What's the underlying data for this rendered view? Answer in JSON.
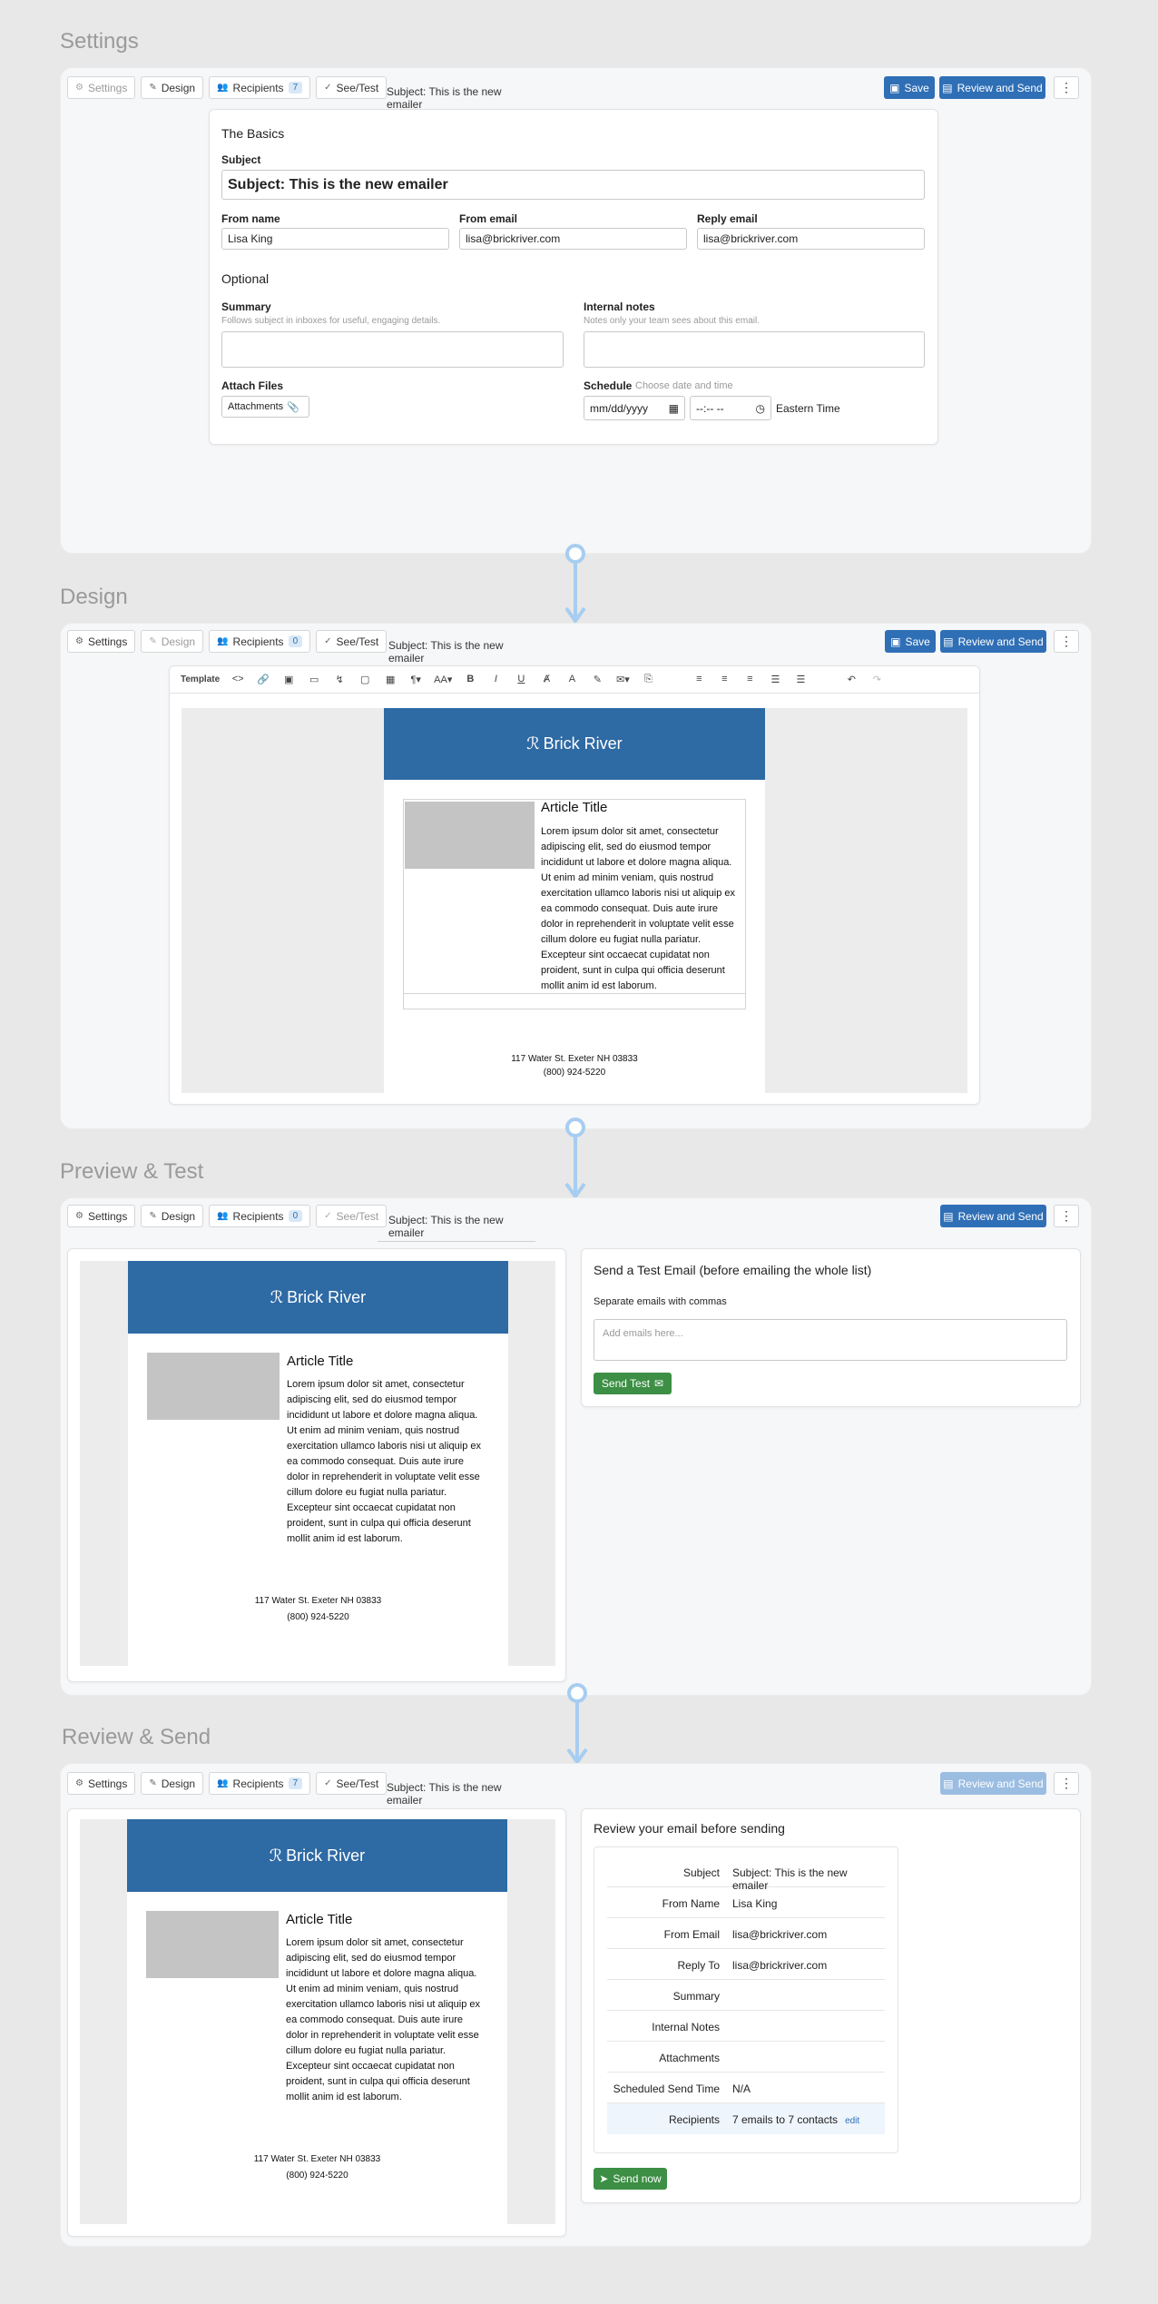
{
  "sections": {
    "settings": "Settings",
    "design": "Design",
    "preview": "Preview & Test",
    "review": "Review & Send"
  },
  "tabs": {
    "settings": "Settings",
    "design": "Design",
    "recipients": "Recipients",
    "seetest": "See/Test"
  },
  "counts": {
    "s1": "7",
    "s2": "0",
    "s3": "0",
    "s4": "7"
  },
  "subject_line": "Subject: This is the new emailer",
  "buttons": {
    "save": "Save",
    "review_send": "Review and Send",
    "send_test": "Send Test",
    "send_now": "Send now"
  },
  "settings": {
    "basics_title": "The Basics",
    "subject_label": "Subject",
    "subject_value": "Subject: This is the new emailer",
    "from_name_label": "From name",
    "from_name_value": "Lisa King",
    "from_email_label": "From email",
    "from_email_value": "lisa@brickriver.com",
    "reply_label": "Reply email",
    "reply_value": "lisa@brickriver.com",
    "optional_title": "Optional",
    "summary_label": "Summary",
    "summary_hint": "Follows subject in inboxes for useful, engaging details.",
    "notes_label": "Internal notes",
    "notes_hint": "Notes only your team sees about this email.",
    "attach_label": "Attach Files",
    "attach_btn": "Attachments",
    "schedule_label": "Schedule",
    "schedule_hint": "Choose date and time",
    "date_placeholder": "mm/dd/yyyy",
    "time_placeholder": "--:-- --",
    "timezone": "Eastern Time"
  },
  "toolbar": {
    "template": "Template"
  },
  "email": {
    "brand": "Brick River",
    "article_title": "Article Title",
    "body_lines": [
      "Lorem ipsum dolor sit amet, consectetur",
      "adipiscing elit, sed do eiusmod tempor",
      "incididunt ut labore et dolore magna aliqua.",
      "Ut enim ad minim veniam, quis nostrud",
      "exercitation ullamco laboris nisi ut aliquip ex",
      "ea commodo consequat. Duis aute irure",
      "dolor in reprehenderit in voluptate velit esse",
      "cillum dolore eu fugiat nulla pariatur.",
      "Excepteur sint occaecat cupidatat non",
      "proident, sunt in culpa qui officia deserunt",
      "mollit anim id est laborum."
    ],
    "address": "117 Water St. Exeter NH 03833",
    "phone": "(800) 924-5220"
  },
  "test": {
    "title": "Send a Test Email (before emailing the whole list)",
    "label": "Separate emails with commas",
    "placeholder": "Add emails here..."
  },
  "review": {
    "title": "Review your email before sending",
    "rows": [
      {
        "k": "Subject",
        "v": "Subject: This is the new emailer"
      },
      {
        "k": "From Name",
        "v": "Lisa King"
      },
      {
        "k": "From Email",
        "v": "lisa@brickriver.com"
      },
      {
        "k": "Reply To",
        "v": "lisa@brickriver.com"
      },
      {
        "k": "Summary",
        "v": ""
      },
      {
        "k": "Internal Notes",
        "v": ""
      },
      {
        "k": "Attachments",
        "v": ""
      },
      {
        "k": "Scheduled Send Time",
        "v": "N/A"
      },
      {
        "k": "Recipients",
        "v": "7 emails to 7 contacts"
      }
    ],
    "edit": "edit"
  },
  "colors": {
    "accent": "#2f6fb6",
    "header": "#2e6aa4",
    "green": "#3c8f44",
    "arrow": "#a7cdf0"
  }
}
